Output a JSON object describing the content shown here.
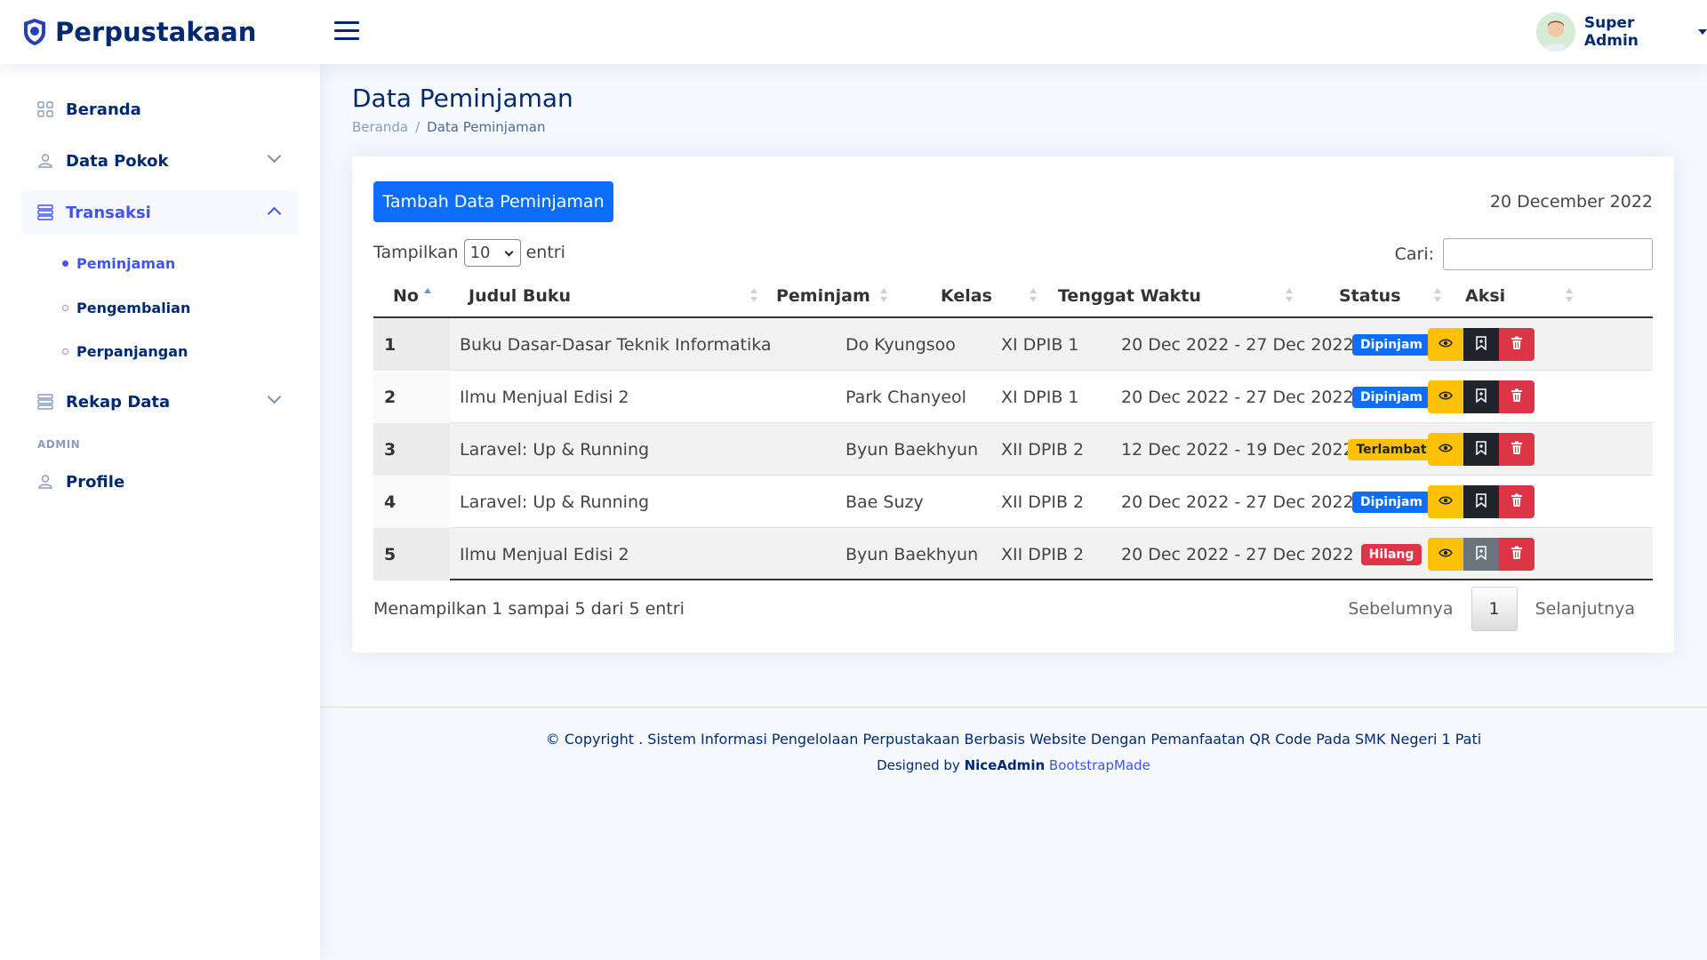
{
  "app": {
    "title": "Perpustakaan"
  },
  "header": {
    "user_name": "Super Admin"
  },
  "sidebar": {
    "items": [
      {
        "label": "Beranda"
      },
      {
        "label": "Data Pokok"
      },
      {
        "label": "Transaksi"
      },
      {
        "label": "Rekap Data"
      }
    ],
    "sub_items": [
      {
        "label": "Peminjaman"
      },
      {
        "label": "Pengembalian"
      },
      {
        "label": "Perpanjangan"
      }
    ],
    "heading": "ADMIN",
    "profile_label": "Profile"
  },
  "page": {
    "title": "Data Peminjaman",
    "breadcrumb": [
      "Beranda",
      "/",
      "Data Peminjaman"
    ]
  },
  "card": {
    "add_button": "Tambah Data Peminjaman",
    "date": "20 December 2022",
    "length_prefix": "Tampilkan",
    "length_value": "10",
    "length_suffix": "entri",
    "search_label": "Cari:",
    "search_value": ""
  },
  "table": {
    "columns": [
      "No",
      "Judul Buku",
      "Peminjam",
      "Kelas",
      "Tenggat Waktu",
      "Status",
      "Aksi"
    ],
    "rows": [
      {
        "no": "1",
        "judul": "Buku Dasar-Dasar Teknik Informatika",
        "peminjam": "Do Kyungsoo",
        "kelas": "XI DPIB 1",
        "tenggat": "20 Dec 2022 - 27 Dec 2022",
        "status": "Dipinjam"
      },
      {
        "no": "2",
        "judul": "Ilmu Menjual Edisi 2",
        "peminjam": "Park Chanyeol",
        "kelas": "XI DPIB 1",
        "tenggat": "20 Dec 2022 - 27 Dec 2022",
        "status": "Dipinjam"
      },
      {
        "no": "3",
        "judul": "Laravel: Up & Running",
        "peminjam": "Byun Baekhyun",
        "kelas": "XII DPIB 2",
        "tenggat": "12 Dec 2022 - 19 Dec 2022",
        "status": "Terlambat"
      },
      {
        "no": "4",
        "judul": "Laravel: Up & Running",
        "peminjam": "Bae Suzy",
        "kelas": "XII DPIB 2",
        "tenggat": "20 Dec 2022 - 27 Dec 2022",
        "status": "Dipinjam"
      },
      {
        "no": "5",
        "judul": "Ilmu Menjual Edisi 2",
        "peminjam": "Byun Baekhyun",
        "kelas": "XII DPIB 2",
        "tenggat": "20 Dec 2022 - 27 Dec 2022",
        "status": "Hilang"
      }
    ],
    "info": "Menampilkan 1 sampai 5 dari 5 entri",
    "prev": "Sebelumnya",
    "page": "1",
    "next": "Selanjutnya"
  },
  "footer": {
    "copyright": "© Copyright . Sistem Informasi Pengelolaan Perpustakaan Berbasis Website Dengan Pemanfaatan QR Code Pada SMK Negeri 1 Pati",
    "designed_by": "Designed by",
    "brand": "NiceAdmin",
    "link": "BootstrapMade"
  },
  "colors": {
    "primary": "#0d6efd",
    "navy": "#012970",
    "accent": "#4154f1",
    "warning": "#ffc107",
    "danger": "#dc3545",
    "dark": "#212529"
  }
}
